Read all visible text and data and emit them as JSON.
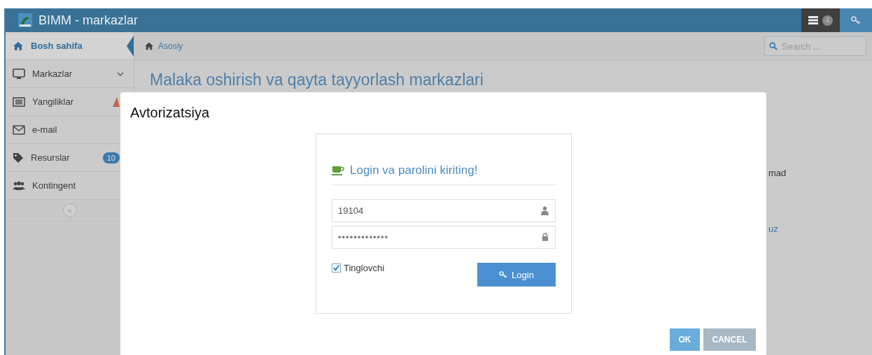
{
  "header": {
    "title": "BIMM - markazlar",
    "notifications_badge": "4"
  },
  "sidebar": {
    "items": [
      {
        "label": "Bosh sahifa",
        "kind": "home",
        "selected": true
      },
      {
        "label": "Markazlar",
        "kind": "monitor",
        "selected": false,
        "expandable": true
      },
      {
        "label": "Yangiliklar",
        "kind": "list",
        "selected": false,
        "alert": true
      },
      {
        "label": "e-mail",
        "kind": "mail",
        "selected": false
      },
      {
        "label": "Resurslar",
        "kind": "tag",
        "selected": false,
        "badge": "10"
      },
      {
        "label": "Kontingent",
        "kind": "users",
        "selected": false
      }
    ],
    "collapse": "«"
  },
  "breadcrumb": {
    "label": "Asosiy"
  },
  "search": {
    "placeholder": "Search ..."
  },
  "page": {
    "title": "Malaka oshirish va qayta tayyorlash markazlari",
    "fragments": [
      "mad",
      "uz"
    ]
  },
  "modal": {
    "title": "Avtorizatsiya",
    "heading": "Login va parolini kiriting!",
    "login": {
      "value": "19104"
    },
    "password": {
      "value": "•••••••••••••"
    },
    "role": {
      "label": "Tinglovchi",
      "checked": true
    },
    "login_button": "Login",
    "buttons": [
      "OK",
      "CANCEL"
    ]
  }
}
